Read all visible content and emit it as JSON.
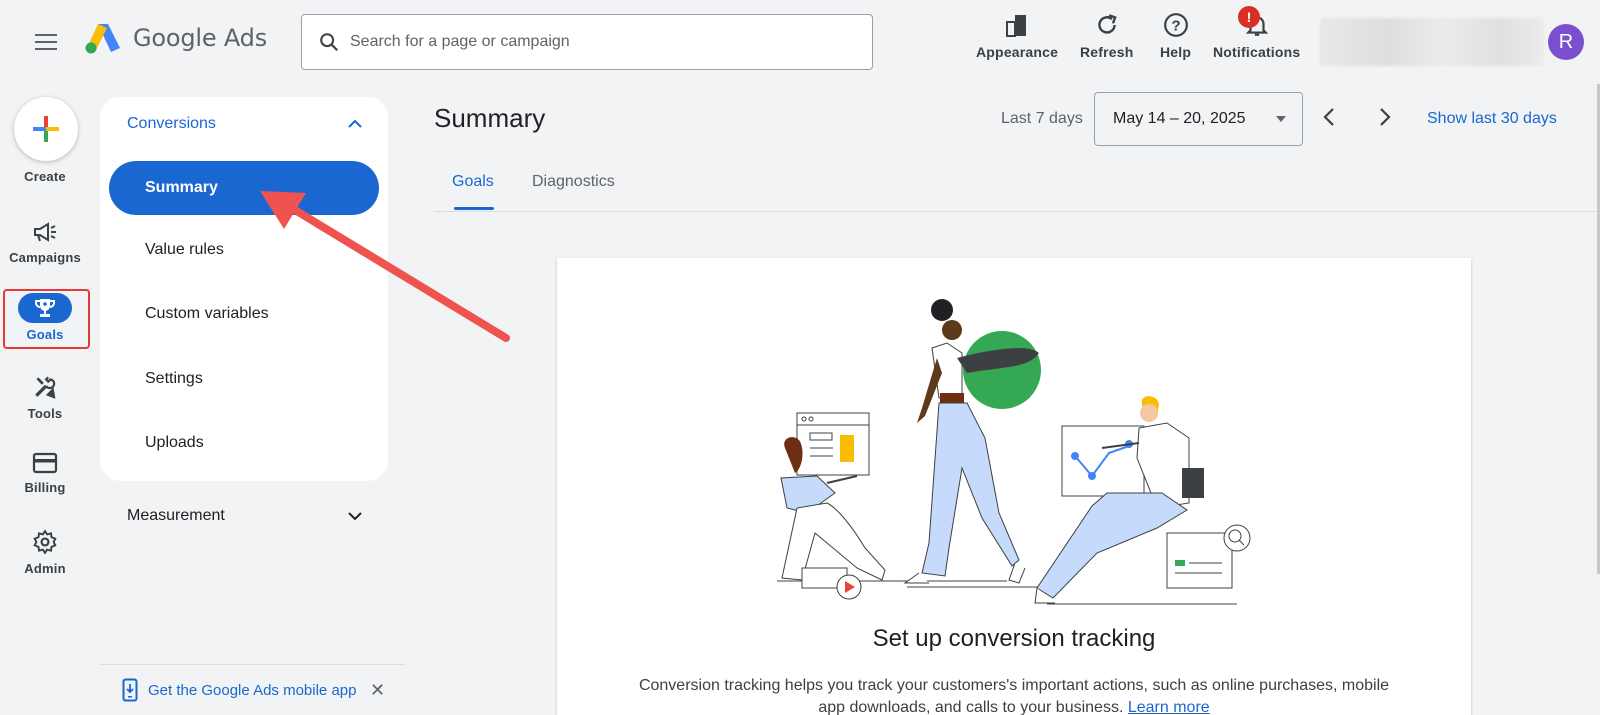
{
  "header": {
    "logo_text": "Google Ads",
    "search_placeholder": "Search for a page or campaign",
    "actions": [
      {
        "label": "Appearance",
        "icon": "appearance-icon"
      },
      {
        "label": "Refresh",
        "icon": "refresh-icon"
      },
      {
        "label": "Help",
        "icon": "help-icon"
      },
      {
        "label": "Notifications",
        "icon": "bell-icon",
        "badge": "!"
      }
    ],
    "avatar_initial": "R"
  },
  "rail": {
    "create": "Create",
    "campaigns": "Campaigns",
    "goals": "Goals",
    "tools": "Tools",
    "billing": "Billing",
    "admin": "Admin"
  },
  "subnav": {
    "section": "Conversions",
    "items": [
      "Summary",
      "Value rules",
      "Custom variables",
      "Settings",
      "Uploads"
    ],
    "active": "Summary",
    "measurement": "Measurement",
    "promo": "Get the Google Ads mobile app"
  },
  "main": {
    "title": "Summary",
    "date_range_label": "Last 7 days",
    "date_range_value": "May 14 – 20, 2025",
    "show_last_30": "Show last 30 days",
    "tabs": [
      "Goals",
      "Diagnostics"
    ],
    "card": {
      "title": "Set up conversion tracking",
      "description": "Conversion tracking helps you track your customers's important actions, such as online purchases, mobile app downloads, and calls to your business.",
      "learn_more": "Learn more"
    }
  },
  "colors": {
    "accent": "#1a67d2",
    "highlight_box": "#e53935",
    "arrow": "#ef5350",
    "avatar": "#7b4fcf",
    "badge": "#d93025"
  }
}
